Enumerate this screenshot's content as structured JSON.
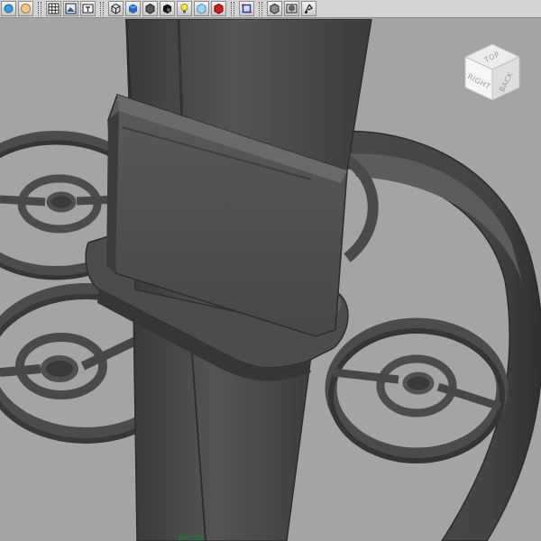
{
  "toolbar": {
    "icons": [
      "snapshot-icon",
      "camera-attrs-icon",
      "grid-icon",
      "image-plane-icon",
      "resolution-gate-icon",
      "wireframe-shading-icon",
      "smooth-shade-icon",
      "default-material-icon",
      "shadows-icon",
      "use-all-lights-icon",
      "xray-icon",
      "textured-icon",
      "isolate-select-icon",
      "frame-all-icon",
      "frame-selected-icon",
      "camera-tools-icon"
    ]
  },
  "viewcube": {
    "faces": {
      "top": "TOP",
      "right": "RIGHT",
      "back": "BACK"
    }
  },
  "viewport": {
    "panel_label": "persp"
  },
  "colors": {
    "background": "#a4a4a4",
    "mesh": "#4c4c4c",
    "mesh_dark": "#353535",
    "mesh_light": "#6a6a6a",
    "status_label": "#0b8a2c"
  }
}
